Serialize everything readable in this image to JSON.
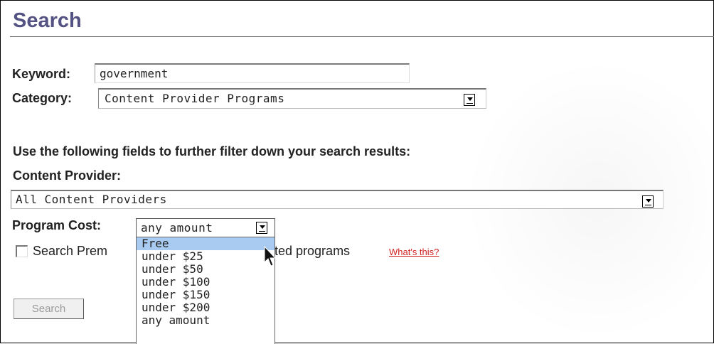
{
  "page": {
    "title": "Search"
  },
  "form": {
    "keyword_label": "Keyword:",
    "keyword_value": "government",
    "category_label": "Category:",
    "category_value": "Content Provider Programs",
    "filter_instructions": "Use the following fields to further filter down your search results:",
    "content_provider_label": "Content Provider:",
    "content_provider_value": "All Content Providers",
    "program_cost_label": "Program Cost:",
    "program_cost_value": "any amount",
    "premium_checkbox_label_start": "Search Prem",
    "premium_checkbox_label_end": "nted programs",
    "premium_checkbox_checked": false,
    "whats_this_link": "What's this?",
    "search_button": "Search"
  },
  "program_cost_dropdown": {
    "options": [
      "Free",
      "under $25",
      "under $50",
      "under $100",
      "under $150",
      "under $200",
      "any amount"
    ],
    "highlighted": "Free"
  },
  "colors": {
    "title": "#535283",
    "link": "#d12222",
    "highlight": "#a9cbf1"
  },
  "icons": {
    "select_arrow": "chevron-down-icon",
    "cursor": "mouse-pointer-icon"
  }
}
